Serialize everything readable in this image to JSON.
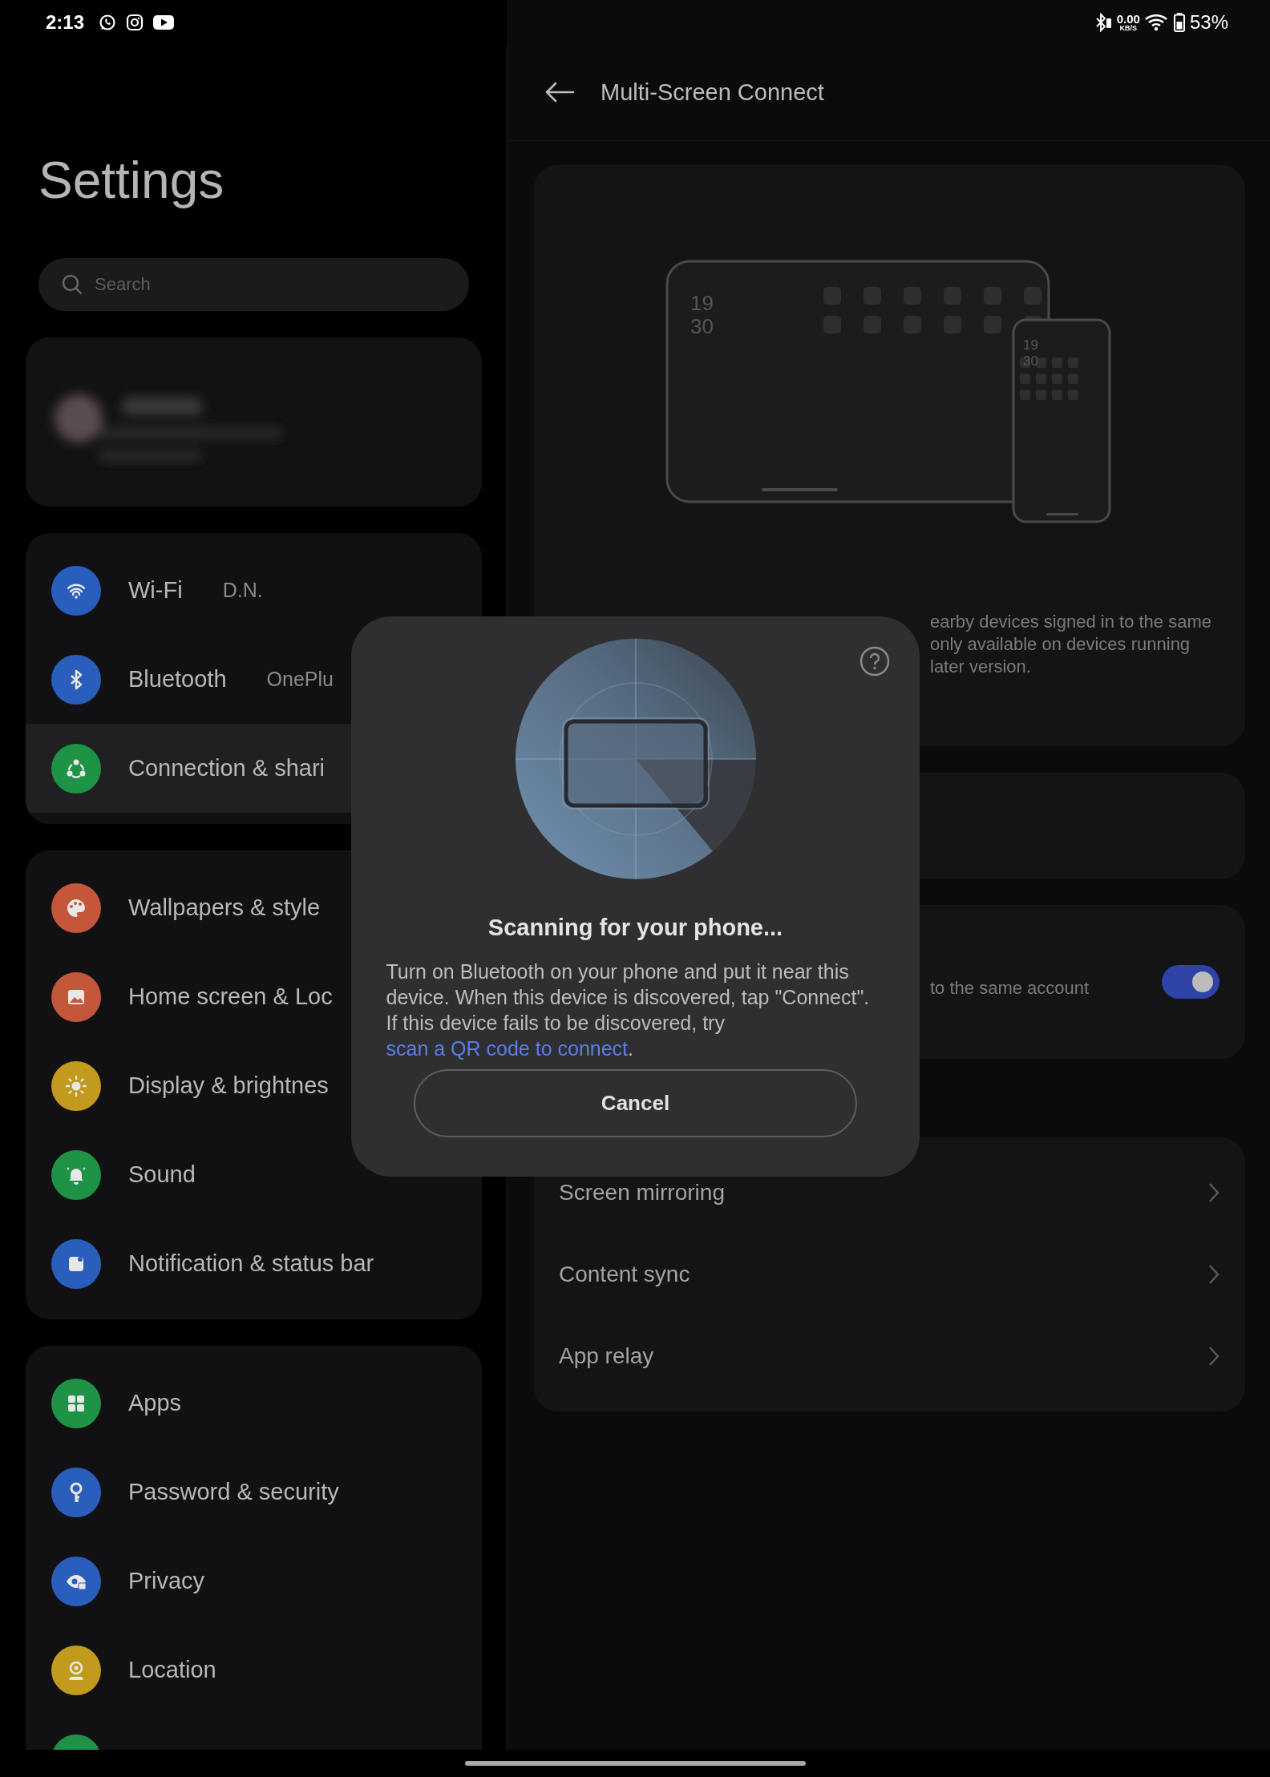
{
  "status_bar": {
    "time": "2:13",
    "data_rate": "0.00",
    "data_unit": "KB/S",
    "battery": "53%"
  },
  "settings": {
    "title": "Settings",
    "search": {
      "placeholder": "Search"
    },
    "groups": [
      {
        "items": [
          {
            "label": "Wi-Fi",
            "value": "D.N.",
            "color": "#2a5ebd",
            "selected": false
          },
          {
            "label": "Bluetooth",
            "value": "OnePlu",
            "color": "#2a5ebd",
            "selected": false
          },
          {
            "label": "Connection & shari",
            "color": "#1e9346",
            "selected": true
          }
        ]
      },
      {
        "items": [
          {
            "label": "Wallpapers & style",
            "color": "#c4563a",
            "selected": false
          },
          {
            "label": "Home screen & Loc",
            "color": "#c4563a",
            "selected": false
          },
          {
            "label": "Display & brightnes",
            "color": "#c29a1d",
            "selected": false
          },
          {
            "label": "Sound",
            "color": "#1e9346",
            "selected": false
          },
          {
            "label": "Notification & status bar",
            "color": "#2a5ebd",
            "selected": false
          }
        ]
      },
      {
        "items": [
          {
            "label": "Apps",
            "color": "#1e9346",
            "selected": false
          },
          {
            "label": "Password & security",
            "color": "#2a5ebd",
            "selected": false
          },
          {
            "label": "Privacy",
            "color": "#2a5ebd",
            "selected": false
          },
          {
            "label": "Location",
            "color": "#c29a1d",
            "selected": false
          },
          {
            "color": "#1e9346",
            "selected": false
          }
        ]
      }
    ]
  },
  "detail": {
    "title": "Multi-Screen Connect",
    "illustration": {
      "tablet_clock": [
        "19",
        "30"
      ],
      "phone_clock": [
        "19",
        "30"
      ]
    },
    "description": [
      "earby devices signed in to the same",
      "only available on devices running",
      "later version."
    ],
    "sync_setting": {
      "description": "to the same account",
      "on": true
    },
    "links": [
      {
        "label": "Screen mirroring"
      },
      {
        "label": "Content sync"
      },
      {
        "label": "App relay"
      }
    ]
  },
  "dialog": {
    "title": "Scanning for your phone...",
    "message": "Turn on Bluetooth on your phone and put it near this device. When this device is discovered, tap \"Connect\". If this device fails to be discovered, try",
    "link": "scan a QR code to connect",
    "message_end": ".",
    "button": "Cancel"
  }
}
